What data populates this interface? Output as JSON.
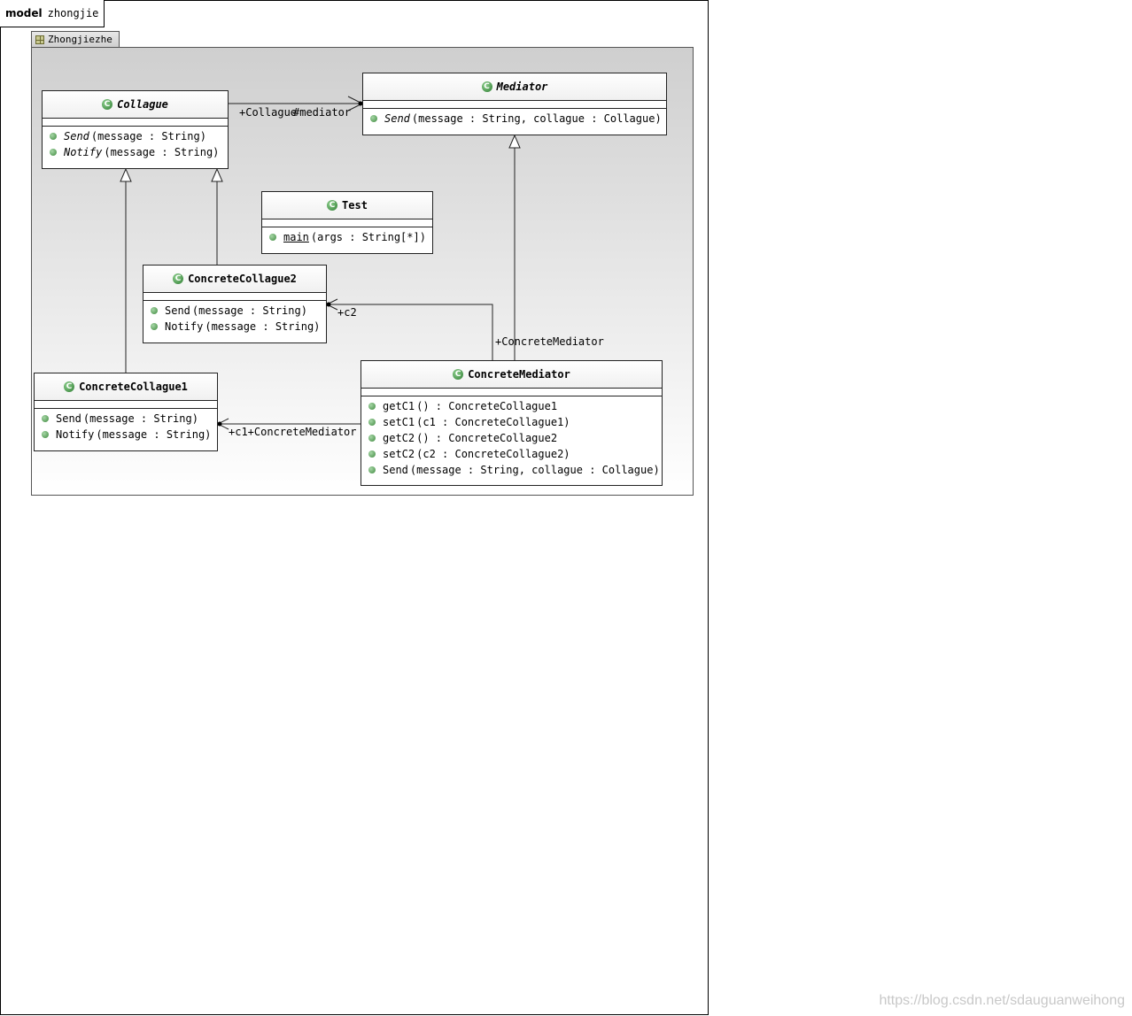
{
  "model_tab": {
    "keyword": "model",
    "name": "zhongjie"
  },
  "package": {
    "name": "Zhongjiezhe"
  },
  "classes": {
    "collague": {
      "name": "Collague",
      "ops": [
        {
          "name": "Send",
          "sig": "(message : String)"
        },
        {
          "name": "Notify",
          "sig": "(message : String)"
        }
      ]
    },
    "mediator": {
      "name": "Mediator",
      "ops": [
        {
          "name": "Send",
          "sig": "(message : String, collague : Collague)"
        }
      ]
    },
    "test": {
      "name": "Test",
      "ops": [
        {
          "name": "main",
          "sig": "(args : String[*])"
        }
      ]
    },
    "concrete_collague2": {
      "name": "ConcreteCollague2",
      "ops": [
        {
          "name": "Send",
          "sig": "(message : String)"
        },
        {
          "name": "Notify",
          "sig": "(message : String)"
        }
      ]
    },
    "concrete_collague1": {
      "name": "ConcreteCollague1",
      "ops": [
        {
          "name": "Send",
          "sig": "(message : String)"
        },
        {
          "name": "Notify",
          "sig": "(message : String)"
        }
      ]
    },
    "concrete_mediator": {
      "name": "ConcreteMediator",
      "ops": [
        {
          "name": "getC1",
          "sig": "() : ConcreteCollague1"
        },
        {
          "name": "setC1",
          "sig": "(c1 : ConcreteCollague1)"
        },
        {
          "name": "getC2",
          "sig": "() : ConcreteCollague2"
        },
        {
          "name": "setC2",
          "sig": "(c2 : ConcreteCollague2)"
        },
        {
          "name": "Send",
          "sig": "(message : String, collague : Collague)"
        }
      ]
    }
  },
  "roles": {
    "collague_end": "+Collague",
    "mediator_end": "#mediator",
    "c2": "+c2",
    "concrete_mediator_top": "+ConcreteMediator",
    "c1_pair": "+c1+ConcreteMediator"
  },
  "class_icon": "C",
  "watermark": "https://blog.csdn.net/sdauguanweihong"
}
